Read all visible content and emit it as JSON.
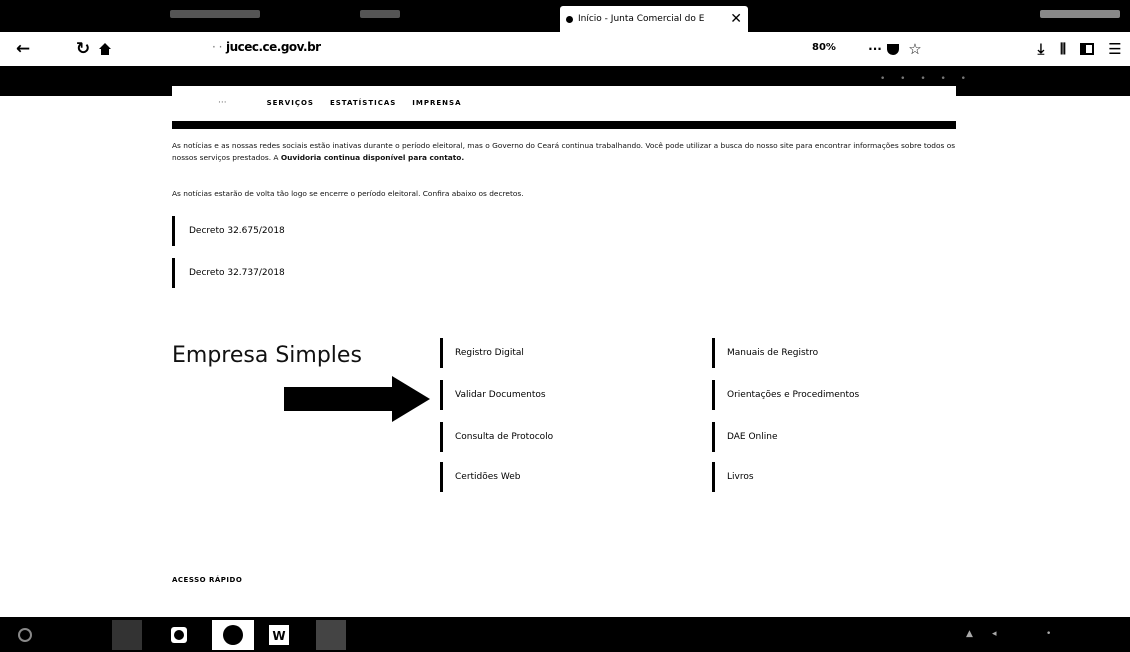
{
  "browser": {
    "tab_title": "Início - Junta Comercial do E",
    "tab_close": "✕",
    "url_prefix": "· ·",
    "url": "jucec.ce.gov.br",
    "zoom": "80%"
  },
  "site_nav": {
    "items": [
      "SERVIÇOS",
      "ESTATÍSTICAS",
      "IMPRENSA"
    ]
  },
  "notice": {
    "text_a": "As notícias e as nossas redes sociais estão inativas durante o período eleitoral, mas o Governo do Ceará continua trabalhando. Você pode utilizar a busca do nosso site para encontrar informações sobre todos os nossos serviços prestados. A ",
    "text_b": "Ouvidoria continua disponível para contato.",
    "text_c": "As notícias estarão de volta tão logo se encerre o período eleitoral. Confira abaixo os decretos."
  },
  "decrees": [
    "Decreto 32.675/2018",
    "Decreto 32.737/2018"
  ],
  "empresa": {
    "title": "Empresa Simples",
    "col1": [
      "Registro Digital",
      "Validar Documentos",
      "Consulta de Protocolo",
      "Certidões Web"
    ],
    "col2": [
      "Manuais de Registro",
      "Orientações e Procedimentos",
      "DAE Online",
      "Livros"
    ]
  },
  "quick_access": "ACESSO RÁPIDO"
}
